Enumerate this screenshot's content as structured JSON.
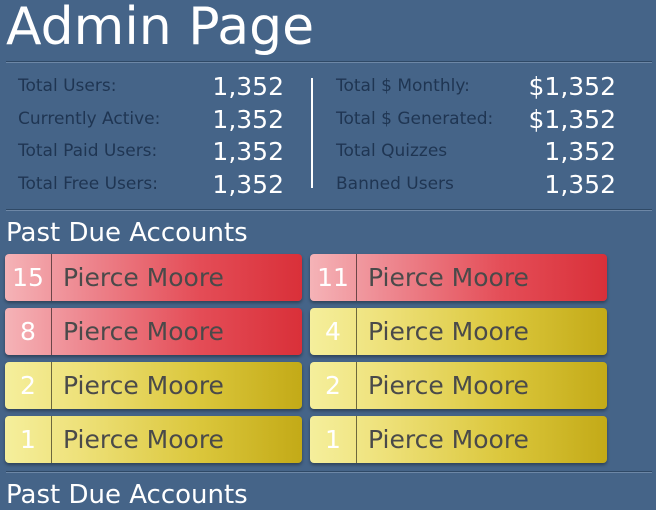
{
  "header": {
    "title": "Admin Page"
  },
  "stats": {
    "left": [
      {
        "label": "Total Users:",
        "value": "1,352"
      },
      {
        "label": "Currently Active:",
        "value": "1,352"
      },
      {
        "label": "Total Paid Users:",
        "value": "1,352"
      },
      {
        "label": "Total Free Users:",
        "value": "1,352"
      }
    ],
    "right": [
      {
        "label": "Total $ Monthly:",
        "value": "$1,352"
      },
      {
        "label": "Total $ Generated:",
        "value": "$1,352"
      },
      {
        "label": "Total Quizzes",
        "value": "1,352"
      },
      {
        "label": "Banned Users",
        "value": "1,352"
      }
    ]
  },
  "past_due": {
    "title": "Past Due Accounts",
    "accounts": [
      {
        "count": "15",
        "name": "Pierce Moore",
        "status": "red"
      },
      {
        "count": "11",
        "name": "Pierce Moore",
        "status": "red"
      },
      {
        "count": "8",
        "name": "Pierce Moore",
        "status": "red"
      },
      {
        "count": "4",
        "name": "Pierce Moore",
        "status": "yellow"
      },
      {
        "count": "2",
        "name": "Pierce Moore",
        "status": "yellow"
      },
      {
        "count": "2",
        "name": "Pierce Moore",
        "status": "yellow"
      },
      {
        "count": "1",
        "name": "Pierce Moore",
        "status": "yellow"
      },
      {
        "count": "1",
        "name": "Pierce Moore",
        "status": "yellow"
      }
    ]
  },
  "past_due_2": {
    "title": "Past Due Accounts"
  },
  "colors": {
    "background": "#456488",
    "label_text": "#1f3552",
    "overdue_red": "#e44d57",
    "overdue_yellow": "#dbc73c"
  }
}
